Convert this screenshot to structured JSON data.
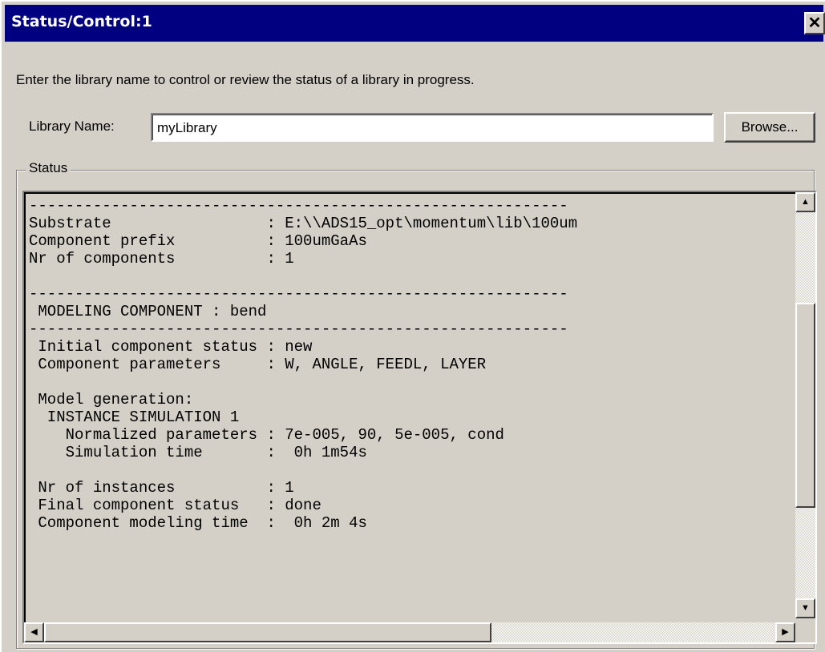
{
  "window": {
    "title": "Status/Control:1",
    "close_label": "✕"
  },
  "instruction": "Enter the library name to control or review the status of a library in progress.",
  "library": {
    "label": "Library Name:",
    "value": "myLibrary",
    "browse_label": "Browse..."
  },
  "status": {
    "group_label": "Status",
    "lines": [
      "-----------------------------------------------------------",
      "Substrate                 : E:\\\\ADS15_opt\\momentum\\lib\\100um",
      "Component prefix          : 100umGaAs",
      "Nr of components          : 1",
      "",
      "-----------------------------------------------------------",
      " MODELING COMPONENT : bend",
      "-----------------------------------------------------------",
      " Initial component status : new",
      " Component parameters     : W, ANGLE, FEEDL, LAYER",
      "",
      " Model generation:",
      "  INSTANCE SIMULATION 1",
      "    Normalized parameters : 7e-005, 90, 5e-005, cond",
      "    Simulation time       :  0h 1m54s",
      "",
      " Nr of instances          : 1",
      " Final component status   : done",
      " Component modeling time  :  0h 2m 4s",
      ""
    ]
  },
  "scrollbars": {
    "up_arrow": "▲",
    "down_arrow": "▼",
    "left_arrow": "◀",
    "right_arrow": "▶"
  }
}
